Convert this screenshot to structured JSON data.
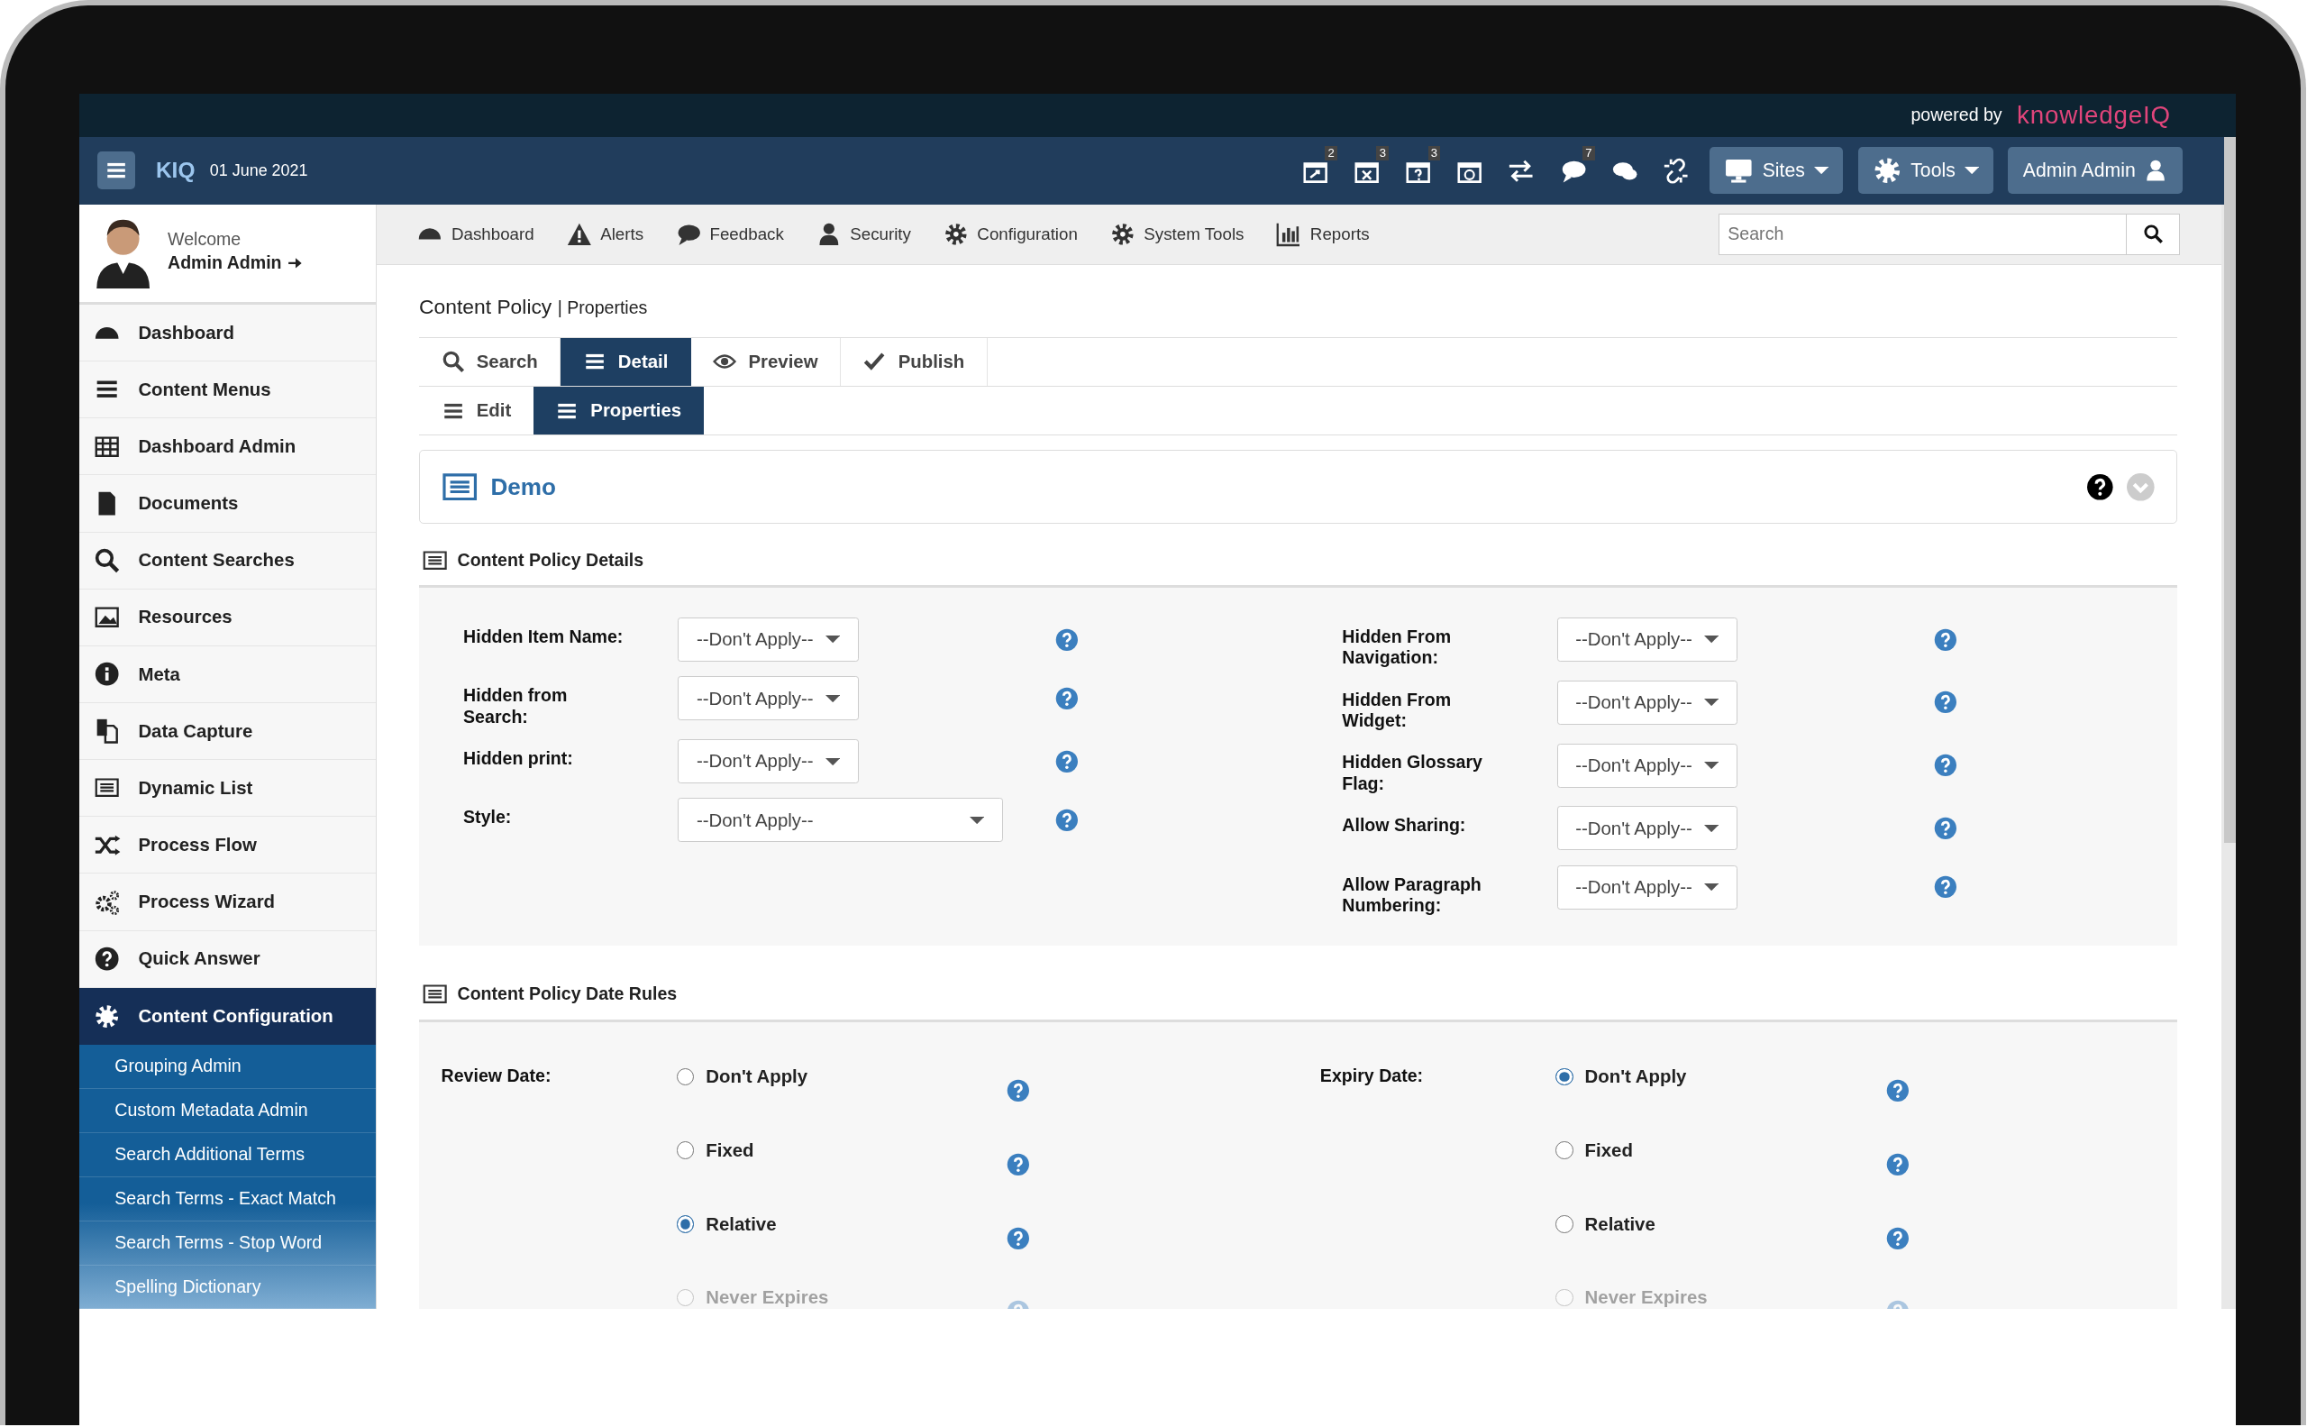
{
  "branding": {
    "powered_by": "powered by",
    "brand": "knowledgeIQ"
  },
  "navbar": {
    "app": "KIQ",
    "date": "01 June 2021",
    "icons": [
      {
        "kind": "calendar-share",
        "badge": "2"
      },
      {
        "kind": "calendar-x",
        "badge": "3"
      },
      {
        "kind": "calendar-question",
        "badge": "3"
      },
      {
        "kind": "calendar-clock"
      },
      {
        "kind": "transfer"
      },
      {
        "kind": "comment",
        "badge": "7"
      },
      {
        "kind": "comments"
      },
      {
        "kind": "unlink"
      }
    ],
    "menus": [
      {
        "label": "Sites"
      },
      {
        "label": "Tools"
      }
    ],
    "user": "Admin Admin"
  },
  "user_panel": {
    "welcome": "Welcome",
    "name": "Admin Admin"
  },
  "sidebar": {
    "items": [
      {
        "label": "Dashboard",
        "selected": false
      },
      {
        "label": "Content Menus",
        "selected": false
      },
      {
        "label": "Dashboard Admin",
        "selected": false
      },
      {
        "label": "Documents",
        "selected": false
      },
      {
        "label": "Content Searches",
        "selected": false
      },
      {
        "label": "Resources",
        "selected": false
      },
      {
        "label": "Meta",
        "selected": false
      },
      {
        "label": "Data Capture",
        "selected": false
      },
      {
        "label": "Dynamic List",
        "selected": false
      },
      {
        "label": "Process Flow",
        "selected": false
      },
      {
        "label": "Process Wizard",
        "selected": false
      },
      {
        "label": "Quick Answer",
        "selected": false
      },
      {
        "label": "Content Configuration",
        "selected": true,
        "children": [
          {
            "label": "Grouping Admin"
          },
          {
            "label": "Custom Metadata Admin"
          },
          {
            "label": "Search Additional Terms"
          },
          {
            "label": "Search Terms - Exact Match"
          },
          {
            "label": "Search Terms - Stop Word"
          },
          {
            "label": "Spelling Dictionary"
          }
        ]
      }
    ]
  },
  "top_menu": {
    "items": [
      {
        "label": "Dashboard"
      },
      {
        "label": "Alerts"
      },
      {
        "label": "Feedback"
      },
      {
        "label": "Security"
      },
      {
        "label": "Configuration"
      },
      {
        "label": "System Tools"
      },
      {
        "label": "Reports"
      }
    ],
    "search": {
      "placeholder": "Search"
    }
  },
  "breadcrumb": {
    "title": "Content Policy",
    "separator": "|",
    "sub": "Properties"
  },
  "tab_rows": [
    [
      {
        "label": "Search",
        "selected": false
      },
      {
        "label": "Detail",
        "selected": true
      },
      {
        "label": "Preview",
        "selected": false
      },
      {
        "label": "Publish",
        "selected": false
      }
    ],
    [
      {
        "label": "Edit",
        "selected": false
      },
      {
        "label": "Properties",
        "selected": true
      }
    ]
  ],
  "panel": {
    "title": "Demo"
  },
  "details": {
    "title": "Content Policy Details",
    "left": [
      {
        "label": "Hidden Item Name:",
        "value": "--Don't Apply--",
        "kind": "select"
      },
      {
        "label": "Hidden from Search:",
        "value": "--Don't Apply--",
        "kind": "select"
      },
      {
        "label": "Hidden print:",
        "value": "--Don't Apply--",
        "kind": "select"
      },
      {
        "label": "Style:",
        "value": "--Don't Apply--",
        "kind": "wide-select"
      }
    ],
    "right": [
      {
        "label": "Hidden From Navigation:",
        "value": "--Don't Apply--",
        "kind": "select"
      },
      {
        "label": "Hidden From Widget:",
        "value": "--Don't Apply--",
        "kind": "select"
      },
      {
        "label": "Hidden Glossary Flag:",
        "value": "--Don't Apply--",
        "kind": "select"
      },
      {
        "label": "Allow Sharing:",
        "value": "--Don't Apply--",
        "kind": "select"
      },
      {
        "label": "Allow Paragraph Numbering:",
        "value": "--Don't Apply--",
        "kind": "select"
      }
    ]
  },
  "date_rules": {
    "title": "Content Policy Date Rules",
    "groups": [
      {
        "label": "Review Date:",
        "options": [
          {
            "label": "Don't Apply",
            "selected": false
          },
          {
            "label": "Fixed",
            "selected": false
          },
          {
            "label": "Relative",
            "selected": true
          },
          {
            "label": "Never Expires",
            "selected": false
          }
        ]
      },
      {
        "label": "Expiry Date:",
        "options": [
          {
            "label": "Don't Apply",
            "selected": true
          },
          {
            "label": "Fixed",
            "selected": false
          },
          {
            "label": "Relative",
            "selected": false
          },
          {
            "label": "Never Expires",
            "selected": false
          }
        ]
      }
    ]
  }
}
